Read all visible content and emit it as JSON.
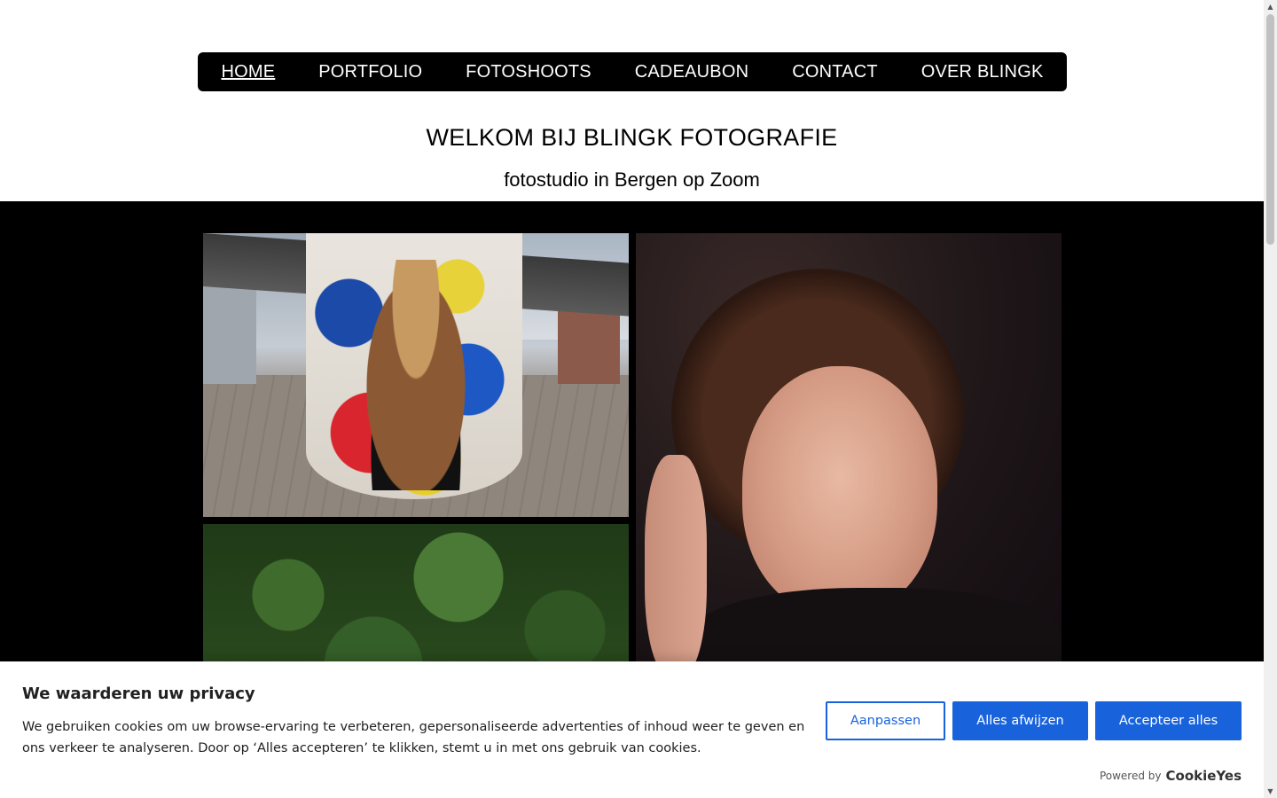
{
  "nav": {
    "items": [
      {
        "label": "HOME",
        "active": true
      },
      {
        "label": "PORTFOLIO"
      },
      {
        "label": "FOTOSHOOTS"
      },
      {
        "label": "CADEAUBON"
      },
      {
        "label": "CONTACT"
      },
      {
        "label": "OVER BLINGK"
      }
    ]
  },
  "header": {
    "title": "WELKOM BIJ BLINGK FOTOGRAFIE",
    "subtitle": "fotostudio in Bergen op Zoom"
  },
  "cookie_banner": {
    "heading": "We waarderen uw privacy",
    "text": "We gebruiken cookies om uw browse-ervaring te verbeteren, gepersonaliseerde advertenties of inhoud weer te geven en ons verkeer te analyseren. Door op ‘Alles accepteren’ te klikken, stemt u in met ons gebruik van cookies.",
    "customize_label": "Aanpassen",
    "reject_label": "Alles afwijzen",
    "accept_label": "Accepteer alles",
    "powered_by": "Powered by",
    "brand": "CookieYes"
  },
  "colors": {
    "nav_bg": "#000000",
    "accent": "#1863dc",
    "gallery_bg": "#000000"
  }
}
